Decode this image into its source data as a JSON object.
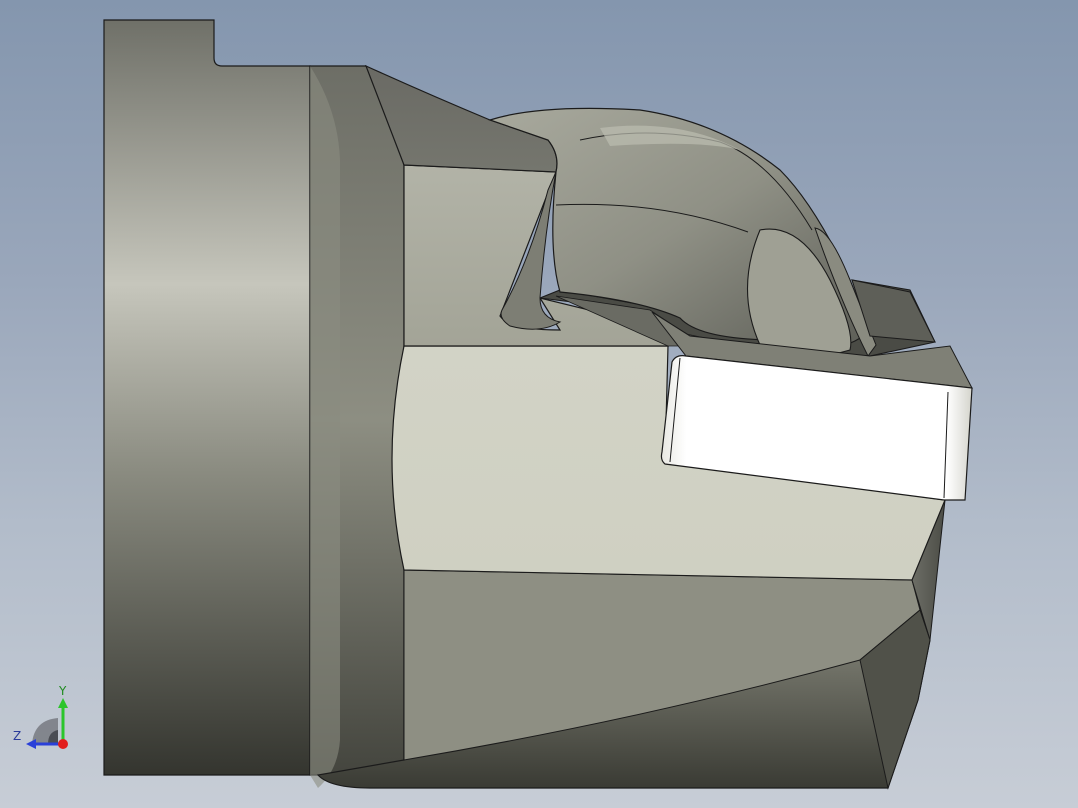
{
  "viewport": {
    "background_top": "#8496ae",
    "background_bottom": "#c7cdd6"
  },
  "model": {
    "edge_color": "#1b1b1b",
    "face_light": "#d2d3c6",
    "face_dark": "#3a3b34",
    "highlight_face": "#ffffff"
  },
  "triad": {
    "y_label": "Y",
    "z_label": "Z",
    "y_color": "#2bc52b",
    "z_color": "#2a40d8",
    "x_color": "#e21d1d"
  }
}
